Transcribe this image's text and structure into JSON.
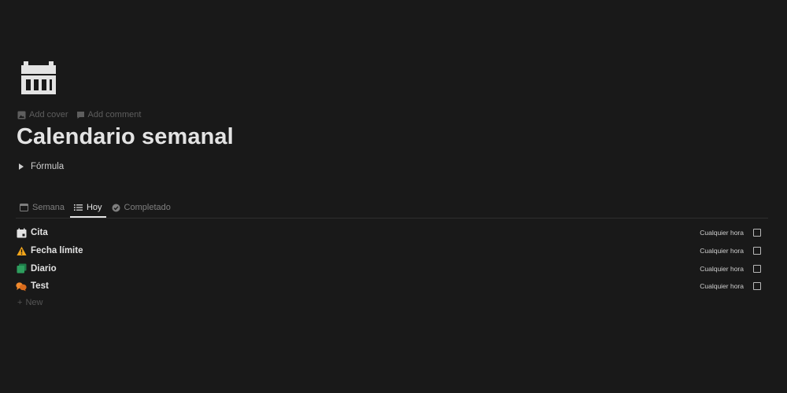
{
  "page": {
    "icon": "calendar-icon",
    "actions": {
      "add_cover": "Add cover",
      "add_comment": "Add comment"
    },
    "title": "Calendario semanal",
    "toggle_label": "Fórmula"
  },
  "views": {
    "tabs": [
      {
        "label": "Semana",
        "icon": "calendar-small-icon",
        "active": false
      },
      {
        "label": "Hoy",
        "icon": "list-icon",
        "active": true
      },
      {
        "label": "Completado",
        "icon": "check-circle-icon",
        "active": false
      }
    ]
  },
  "rows": [
    {
      "title": "Cita",
      "icon": "calendar-event-icon",
      "time": "Cualquier hora",
      "checked": false
    },
    {
      "title": "Fecha límite",
      "icon": "warning-icon",
      "time": "Cualquier hora",
      "checked": false
    },
    {
      "title": "Diario",
      "icon": "notebook-icon",
      "time": "Cualquier hora",
      "checked": false
    },
    {
      "title": "Test",
      "icon": "speech-bubbles-icon",
      "time": "Cualquier hora",
      "checked": false
    }
  ],
  "new_label": "New",
  "colors": {
    "background": "#191919",
    "text": "#e3e3e3",
    "muted": "#7f7f7f",
    "warning": "#f2a51a",
    "diario": "#2e9e5e",
    "test": "#e07b24"
  }
}
